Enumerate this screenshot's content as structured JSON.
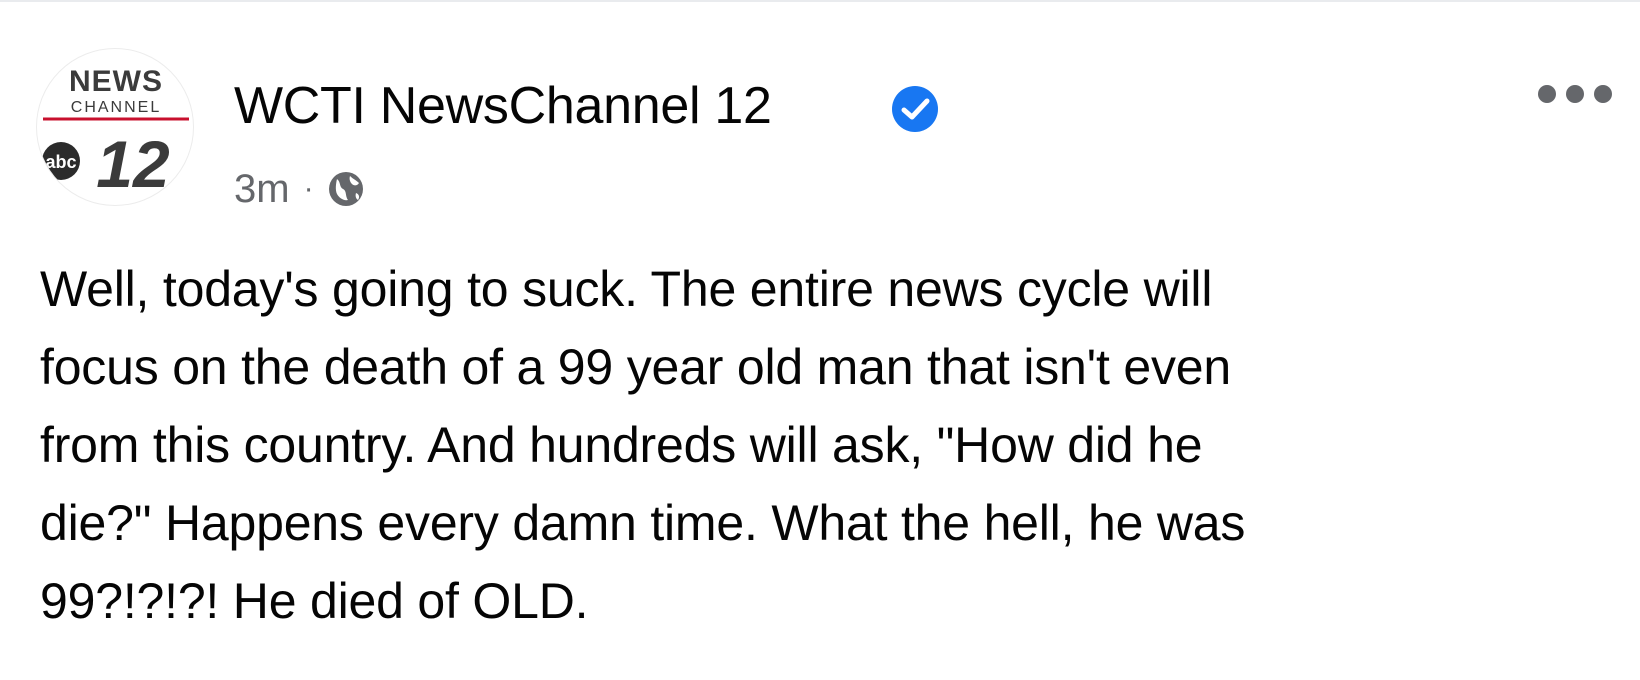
{
  "post": {
    "page_name": "WCTI NewsChannel 12",
    "verified": true,
    "timestamp": "3m",
    "separator": "·",
    "audience_icon": "globe-icon",
    "more_icon": "more-options-icon",
    "avatar": {
      "logo_top": "NEWS",
      "logo_channel": "CHANNEL",
      "logo_network": "abc",
      "logo_number": "12"
    },
    "text": "Well, today's going to suck. The entire news cycle will\nfocus on the death of a 99 year old man that isn't even\nfrom this country. And hundreds will ask, \"How did he\ndie?\" Happens every damn time. What the hell, he was\n99?!?!?! He died of OLD."
  },
  "colors": {
    "name_text": "#050505",
    "secondary_text": "#65676b",
    "verified_badge": "#1877f2",
    "logo_red": "#c8102e"
  }
}
